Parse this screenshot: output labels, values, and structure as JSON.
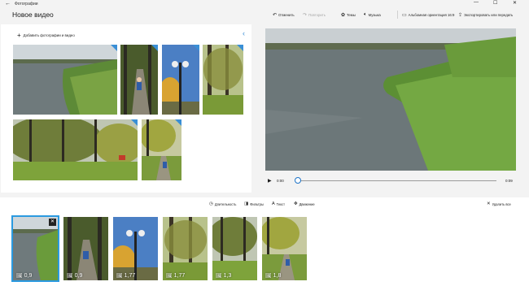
{
  "titlebar": {
    "app_title": "Фотографии",
    "back_icon": "back-arrow-icon",
    "minimize": "—",
    "maximize": "☐",
    "close": "✕"
  },
  "toolbar": {
    "video_title": "Новое видео",
    "undo_label": "Отменить",
    "redo_label": "Повторить",
    "themes_label": "Темы",
    "music_label": "Музыка",
    "orientation_label": "Альбомная ориентация 16:9",
    "export_label": "Экспортировать или передать"
  },
  "library": {
    "add_label": "Добавить фотографии и видео",
    "items": [
      {
        "scene": "lake"
      },
      {
        "scene": "path"
      },
      {
        "scene": "lamp"
      },
      {
        "scene": "trees"
      },
      {
        "scene": "park"
      },
      {
        "scene": "path2"
      }
    ]
  },
  "player": {
    "current_time": "0:00",
    "end_time": "0:09",
    "progress": 0.0
  },
  "storyboard": {
    "tools": {
      "duration": "Длительность",
      "filters": "Фильтры",
      "text": "Текст",
      "motion": "Движение",
      "delete_all": "Удалить все"
    },
    "cards": [
      {
        "duration": "0,9",
        "scene": "lake",
        "selected": true
      },
      {
        "duration": "0,9",
        "scene": "path",
        "selected": false
      },
      {
        "duration": "1,77",
        "scene": "lamp",
        "selected": false
      },
      {
        "duration": "1,77",
        "scene": "trees",
        "selected": false
      },
      {
        "duration": "1,3",
        "scene": "park",
        "selected": false
      },
      {
        "duration": "1,8",
        "scene": "path2",
        "selected": false
      }
    ]
  },
  "colors": {
    "accent": "#2b9ae0",
    "panel_bg": "#ffffff",
    "app_bg": "#f3f3f3"
  }
}
